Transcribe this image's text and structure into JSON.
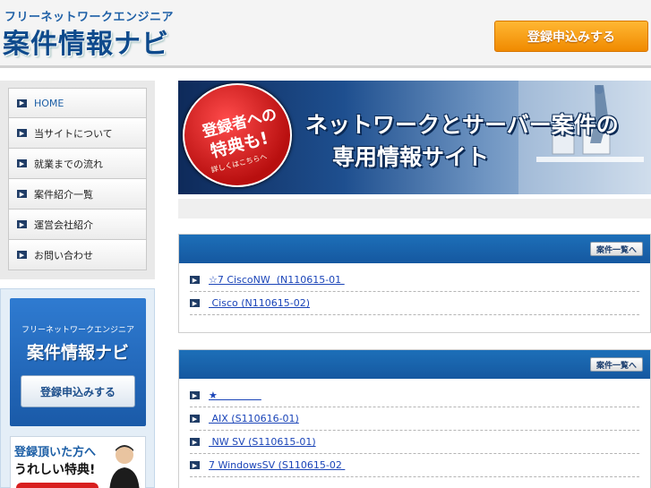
{
  "header": {
    "logo_sub": "フリーネットワークエンジニア",
    "logo_main": "案件情報ナビ",
    "register_button": "登録申込みする"
  },
  "sidebar": {
    "items": [
      {
        "label": "HOME"
      },
      {
        "label": "当サイトについて"
      },
      {
        "label": "就業までの流れ"
      },
      {
        "label": "案件紹介一覧"
      },
      {
        "label": "運営会社紹介"
      },
      {
        "label": "お問い合わせ"
      }
    ]
  },
  "side_banner": {
    "sub": "フリーネットワークエンジニア",
    "main": "案件情報ナビ",
    "register_button": "登録申込みする",
    "promo_line1": "登録頂いた方へ",
    "promo_line2": "うれしい特典!"
  },
  "hero": {
    "seal_line1": "登録者への",
    "seal_line2": "特典も!",
    "seal_line3": "詳しくはこちらへ",
    "headline_line1": "ネットワークとサーバー案件の",
    "headline_line2": "専用情報サイト"
  },
  "job_boxes": [
    {
      "button": "案件一覧へ",
      "items": [
        {
          "text": "☆7 CiscoNW  (N110615-01 "
        },
        {
          "text": " Cisco (N110615-02)"
        }
      ]
    },
    {
      "button": "案件一覧へ",
      "items": [
        {
          "text": "★              "
        },
        {
          "text": " AIX (S110616-01)"
        },
        {
          "text": " NW SV (S110615-01)"
        },
        {
          "text": "7 WindowsSV (S110615-02 "
        }
      ]
    }
  ],
  "colors": {
    "brand_blue": "#1558a0",
    "accent_orange": "#f08a00",
    "link_blue": "#1a44b8"
  }
}
